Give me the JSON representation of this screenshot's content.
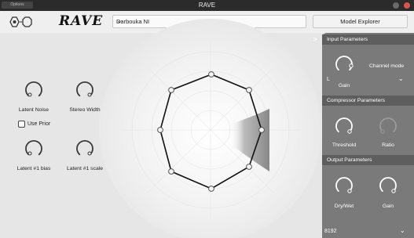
{
  "window": {
    "options_label": "Options",
    "title": "RAVE"
  },
  "header": {
    "brand": "RAVE",
    "preset_value": "Darbouka NI",
    "model_explorer_label": "Model Explorer"
  },
  "left_controls": {
    "latent_noise_label": "Latent Noise",
    "stereo_width_label": "Stereo Width",
    "use_prior_label": "Use Prior",
    "latent_bias_label": "Latent #1 bias",
    "latent_scale_label": "Latent #1 scale"
  },
  "right_panel": {
    "toggle_glyph": ">",
    "input_section": "Input Parameters",
    "input_gain_label": "Gain",
    "channel_mode_label": "Channel mode",
    "channel_mode_value": "L",
    "compressor_section": "Compressor Parameters",
    "threshold_label": "Threshold",
    "ratio_label": "Ratio",
    "output_section": "Output Parameters",
    "dry_wet_label": "Dry/Wet",
    "output_gain_label": "Gain",
    "buffer_size_value": "8192"
  },
  "colors": {
    "title_bar": "#2b2b2b",
    "background": "#e6e6e6",
    "panel": "#7a7a7a",
    "section_header": "#5e5e5e",
    "close": "#d9534f",
    "minimize": "#6a6a6a"
  },
  "icons": {
    "logo": "rave-logo-icon",
    "dropdown": "chevron-down-icon",
    "panel_toggle": "chevron-right-icon"
  }
}
